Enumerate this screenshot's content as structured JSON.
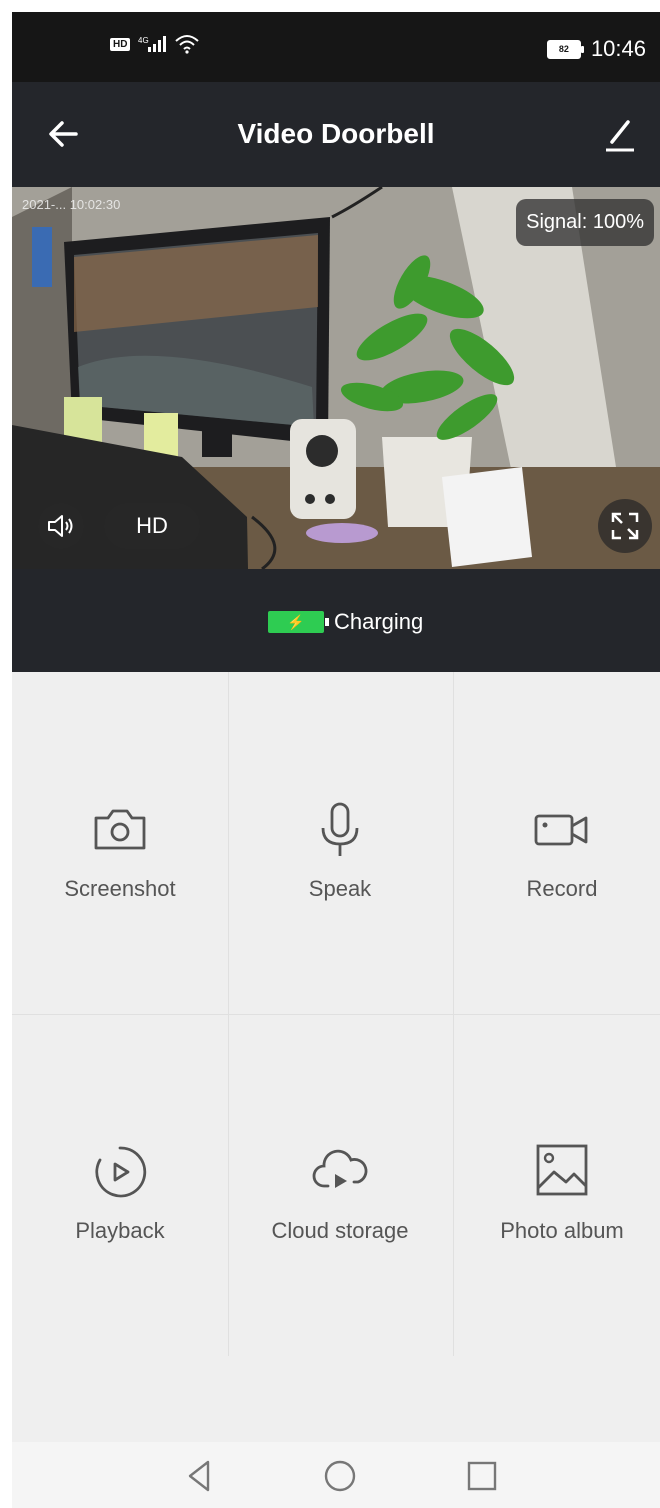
{
  "status_bar": {
    "time": "10:46",
    "battery": "82",
    "network_badge": "HD",
    "signal_label": "4G"
  },
  "header": {
    "title": "Video Doorbell",
    "back_icon": "arrow-left-icon",
    "edit_icon": "pencil-icon"
  },
  "video": {
    "signal_text": "Signal: 100%",
    "quality_label": "HD",
    "timestamp": "2021-... 10:02:30"
  },
  "charging": {
    "label": "Charging"
  },
  "actions": [
    {
      "label": "Screenshot",
      "icon": "camera-icon"
    },
    {
      "label": "Speak",
      "icon": "microphone-icon"
    },
    {
      "label": "Record",
      "icon": "video-camera-icon"
    },
    {
      "label": "Playback",
      "icon": "playback-icon"
    },
    {
      "label": "Cloud storage",
      "icon": "cloud-play-icon"
    },
    {
      "label": "Photo album",
      "icon": "image-icon"
    }
  ],
  "colors": {
    "header_bg": "#24262b",
    "status_bg": "#161616",
    "battery_green": "#2ecc52",
    "grid_bg": "#efefef"
  }
}
